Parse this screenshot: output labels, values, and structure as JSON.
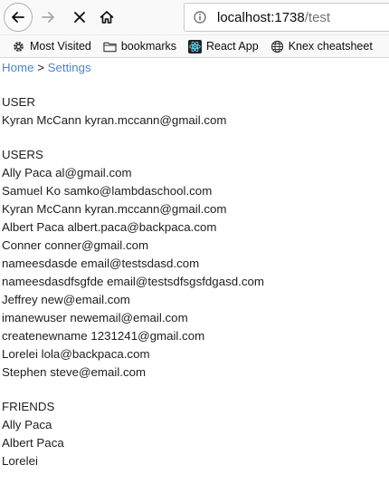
{
  "browser": {
    "url_host": "localhost:1738",
    "url_path": "/test",
    "bookmarks": [
      {
        "label": "Most Visited",
        "icon": "gear-icon"
      },
      {
        "label": "bookmarks",
        "icon": "folder-icon"
      },
      {
        "label": "React App",
        "icon": "react-icon"
      },
      {
        "label": "Knex cheatsheet",
        "icon": "globe-icon"
      }
    ]
  },
  "breadcrumb": {
    "home": "Home",
    "separator": ">",
    "settings": "Settings"
  },
  "user_section": {
    "title": "USER",
    "user": {
      "name": "Kyran McCann",
      "email": "kyran.mccann@gmail.com"
    }
  },
  "users_section": {
    "title": "USERS",
    "users": [
      {
        "name": "Ally Paca",
        "email": "al@gmail.com"
      },
      {
        "name": "Samuel Ko",
        "email": "samko@lambdaschool.com"
      },
      {
        "name": "Kyran McCann",
        "email": "kyran.mccann@gmail.com"
      },
      {
        "name": "Albert Paca",
        "email": "albert.paca@backpaca.com"
      },
      {
        "name": "Conner",
        "email": "conner@gmail.com"
      },
      {
        "name": "nameesdasde",
        "email": "email@testsdasd.com"
      },
      {
        "name": "nameesdasdfsgfde",
        "email": "email@testsdfsgsfdgasd.com"
      },
      {
        "name": "Jeffrey",
        "email": "new@email.com"
      },
      {
        "name": "imanewuser",
        "email": "newemail@email.com"
      },
      {
        "name": "createnewname",
        "email": "1231241@gmail.com"
      },
      {
        "name": "Lorelei",
        "email": "lola@backpaca.com"
      },
      {
        "name": "Stephen",
        "email": "steve@email.com"
      }
    ]
  },
  "friends_section": {
    "title": "FRIENDS",
    "friends": [
      "Ally Paca",
      "Albert Paca",
      "Lorelei"
    ]
  }
}
